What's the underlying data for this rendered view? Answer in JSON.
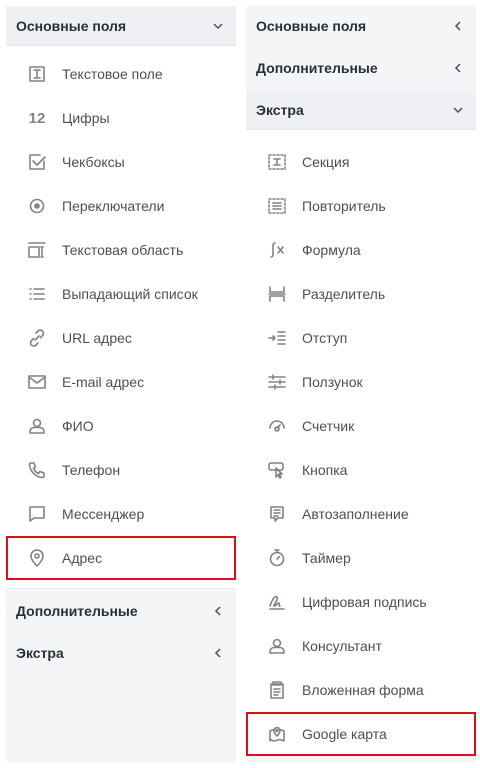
{
  "left": {
    "sections": {
      "basic": "Основные поля",
      "extra": "Дополнительные",
      "extras2": "Экстра"
    },
    "items": [
      {
        "label": "Текстовое поле",
        "icon": "text-field-icon"
      },
      {
        "label": "Цифры",
        "icon": "numbers-icon",
        "glyph": "12"
      },
      {
        "label": "Чекбоксы",
        "icon": "checkbox-icon"
      },
      {
        "label": "Переключатели",
        "icon": "radio-icon"
      },
      {
        "label": "Текстовая область",
        "icon": "textarea-icon"
      },
      {
        "label": "Выпадающий список",
        "icon": "list-icon"
      },
      {
        "label": "URL адрес",
        "icon": "link-icon"
      },
      {
        "label": "E-mail адрес",
        "icon": "mail-icon"
      },
      {
        "label": "ФИО",
        "icon": "person-icon"
      },
      {
        "label": "Телефон",
        "icon": "phone-icon"
      },
      {
        "label": "Мессенджер",
        "icon": "chat-icon"
      },
      {
        "label": "Адрес",
        "icon": "location-pin-icon"
      }
    ]
  },
  "right": {
    "sections": {
      "basic": "Основные поля",
      "extra": "Дополнительные",
      "extras2": "Экстра"
    },
    "items": [
      {
        "label": "Секция",
        "icon": "section-icon"
      },
      {
        "label": "Повторитель",
        "icon": "repeater-icon"
      },
      {
        "label": "Формула",
        "icon": "formula-icon"
      },
      {
        "label": "Разделитель",
        "icon": "divider-icon"
      },
      {
        "label": "Отступ",
        "icon": "indent-icon"
      },
      {
        "label": "Ползунок",
        "icon": "slider-icon"
      },
      {
        "label": "Счетчик",
        "icon": "counter-icon"
      },
      {
        "label": "Кнопка",
        "icon": "button-icon"
      },
      {
        "label": "Автозаполнение",
        "icon": "autofill-icon"
      },
      {
        "label": "Таймер",
        "icon": "timer-icon"
      },
      {
        "label": "Цифровая подпись",
        "icon": "signature-icon"
      },
      {
        "label": "Консультант",
        "icon": "consultant-icon"
      },
      {
        "label": "Вложенная форма",
        "icon": "nested-form-icon"
      },
      {
        "label": "Google карта",
        "icon": "map-icon"
      }
    ]
  },
  "colors": {
    "highlight": "#d9101a",
    "panel": "#f4f5f7",
    "text": "#4a4f57",
    "heading": "#2a2f36"
  }
}
